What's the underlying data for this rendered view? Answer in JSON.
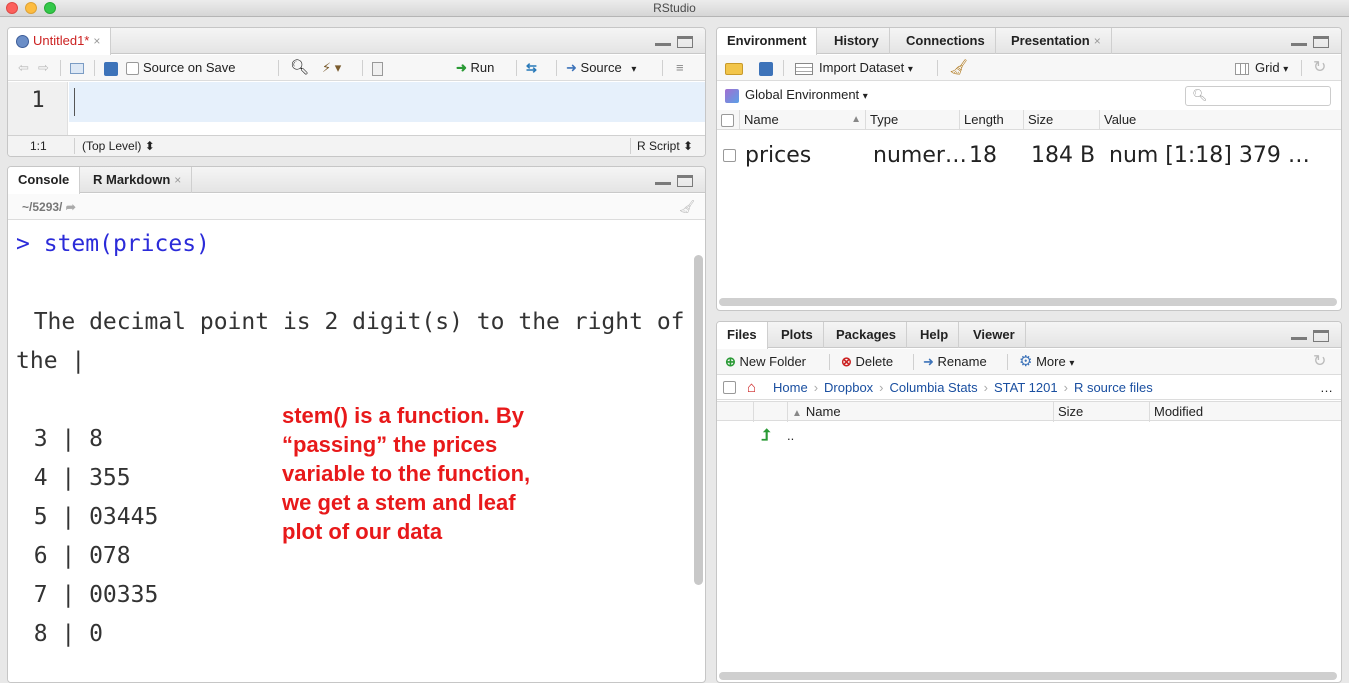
{
  "window": {
    "title": "RStudio"
  },
  "source": {
    "tab_label": "Untitled1*",
    "source_on_save": "Source on Save",
    "run": "Run",
    "source_btn": "Source",
    "line_number": "1",
    "status_pos": "1:1",
    "status_scope": "(Top Level) ⬍",
    "status_type": "R Script ⬍"
  },
  "console": {
    "tabs": [
      "Console",
      "R Markdown"
    ],
    "path": "~/5293/",
    "prompt": ">",
    "command": "stem(prices)",
    "output_line1": "  The decimal point is 2 digit(s) to the right of",
    "output_line2": "the |",
    "stem_rows": [
      "  3 | 8",
      "  4 | 355",
      "  5 | 03445",
      "  6 | 078",
      "  7 | 00335",
      "  8 | 0"
    ],
    "annotation": "stem() is a function. By\n“passing” the prices\nvariable to the function,\nwe get a stem and leaf\nplot of our data",
    "annotation_color": "#e8191a"
  },
  "env": {
    "tabs": [
      "Environment",
      "History",
      "Connections",
      "Presentation"
    ],
    "import_dataset": "Import Dataset",
    "grid": "Grid",
    "global_env": "Global Environment",
    "columns": [
      "Name",
      "Type",
      "Length",
      "Size",
      "Value"
    ],
    "rows": [
      {
        "name": "prices",
        "type": "numer…",
        "length": "18",
        "size": "184 B",
        "value": "num [1:18] 379 …"
      }
    ]
  },
  "files": {
    "tabs": [
      "Files",
      "Plots",
      "Packages",
      "Help",
      "Viewer"
    ],
    "new_folder": "New Folder",
    "delete": "Delete",
    "rename": "Rename",
    "more": "More",
    "breadcrumb": [
      "Home",
      "Dropbox",
      "Columbia Stats",
      "STAT 1201",
      "R source files"
    ],
    "columns": [
      "Name",
      "Size",
      "Modified"
    ],
    "parent_dir": ".."
  }
}
